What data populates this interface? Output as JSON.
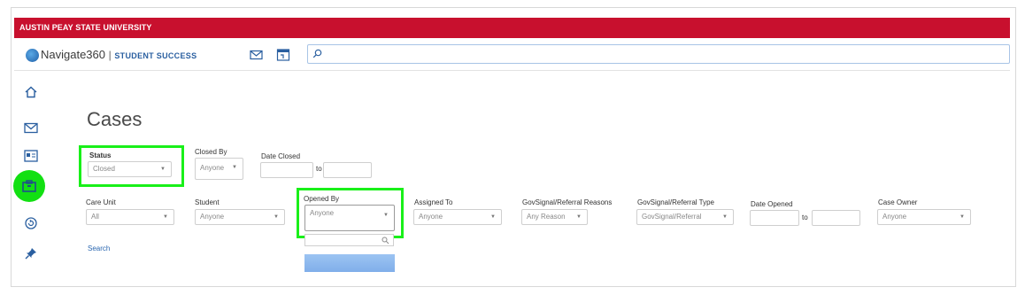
{
  "header": {
    "university": "AUSTIN PEAY STATE UNIVERSITY",
    "brand": "Navigate360",
    "brand_separator": "|",
    "brand_sub": "STUDENT SUCCESS",
    "search_placeholder": ""
  },
  "nav_icons": [
    "mail-icon",
    "calendar-icon"
  ],
  "sidebar": {
    "items": [
      "home-icon",
      "mail-icon",
      "profile-card-icon",
      "cases-icon",
      "refresh-icon",
      "pin-icon"
    ],
    "active": "cases-icon"
  },
  "page": {
    "title": "Cases"
  },
  "filters": {
    "status": {
      "label": "Status",
      "value": "Closed"
    },
    "closed_by": {
      "label": "Closed By",
      "value": "Anyone"
    },
    "date_closed": {
      "label": "Date Closed",
      "from": "",
      "to_label": "to",
      "to": ""
    },
    "care_unit": {
      "label": "Care Unit",
      "value": "All"
    },
    "student": {
      "label": "Student",
      "value": "Anyone"
    },
    "opened_by": {
      "label": "Opened By",
      "value": "Anyone"
    },
    "assigned_to": {
      "label": "Assigned To",
      "value": "Anyone"
    },
    "reasons": {
      "label": "GovSignal/Referral Reasons",
      "value": "Any Reason"
    },
    "type": {
      "label": "GovSignal/Referral Type",
      "value": "GovSignal/Referral"
    },
    "date_opened": {
      "label": "Date Opened",
      "from": "",
      "to_label": "to",
      "to": ""
    },
    "case_owner": {
      "label": "Case Owner",
      "value": "Anyone"
    }
  },
  "actions": {
    "search_label": "Search"
  },
  "colors": {
    "brand_red": "#c8102e",
    "highlight_green": "#19f019",
    "link_blue": "#2a66b0"
  }
}
